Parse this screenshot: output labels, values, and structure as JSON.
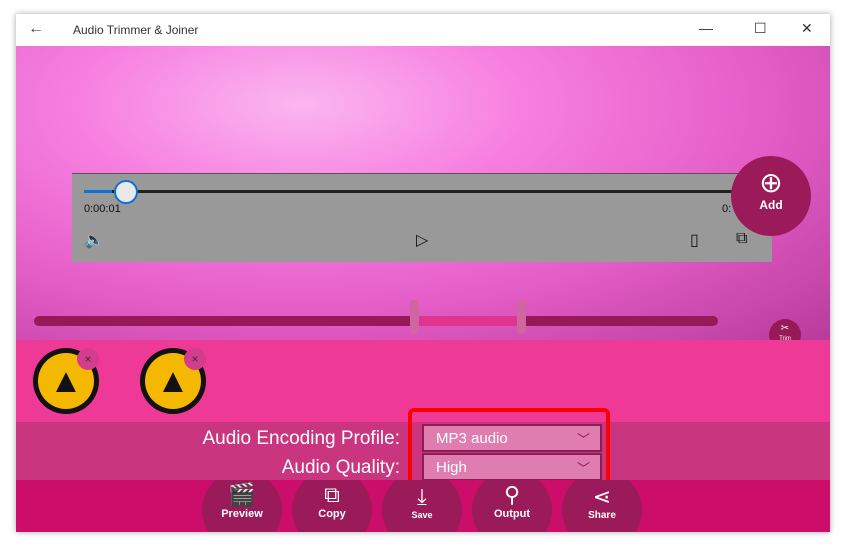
{
  "window": {
    "title": "Audio Trimmer & Joiner",
    "back": "←",
    "minimize": "—",
    "maximize": "☐",
    "close": "✕"
  },
  "player": {
    "current_time": "0:00:01",
    "end_time": "0:",
    "progress_percent": 4
  },
  "add_button": {
    "label": "Add",
    "icon": "play-plus-icon"
  },
  "trim_button": {
    "label": "Trim",
    "icon": "scissors-icon"
  },
  "files": [
    {
      "icon": "aimp-icon",
      "remove": "×"
    },
    {
      "icon": "aimp-icon",
      "remove": "×"
    }
  ],
  "settings": {
    "encoding_label": "Audio Encoding Profile:",
    "encoding_value": "MP3 audio",
    "quality_label": "Audio Quality:",
    "quality_value": "High"
  },
  "actions": [
    {
      "label": "Preview",
      "icon": "clapperboard-icon"
    },
    {
      "label": "Copy",
      "icon": "copy-icon"
    },
    {
      "label": "Save",
      "icon": "download-icon"
    },
    {
      "label": "Output",
      "icon": "output-icon"
    },
    {
      "label": "Share",
      "icon": "share-icon"
    }
  ],
  "colors": {
    "accent": "#9b1a5a",
    "files_bg": "#ee3a96",
    "highlight": "#ff0000"
  }
}
